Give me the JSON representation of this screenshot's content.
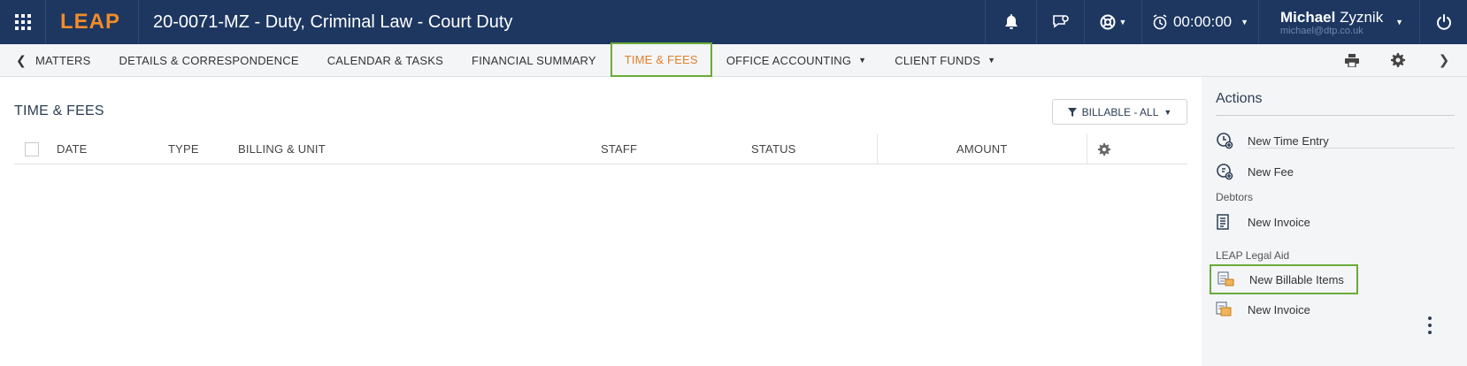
{
  "topbar": {
    "logo": "LEAP",
    "matter_title": "20-0071-MZ - Duty, Criminal Law - Court Duty",
    "timer": "00:00:00",
    "user_first": "Michael",
    "user_last": "Zyznik",
    "user_email": "michael@dtp.co.uk"
  },
  "nav": {
    "back_label": "MATTERS",
    "tabs": [
      {
        "label": "DETAILS & CORRESPONDENCE"
      },
      {
        "label": "CALENDAR & TASKS"
      },
      {
        "label": "FINANCIAL SUMMARY"
      },
      {
        "label": "TIME & FEES"
      },
      {
        "label": "OFFICE ACCOUNTING"
      },
      {
        "label": "CLIENT FUNDS"
      }
    ]
  },
  "main": {
    "title": "TIME & FEES",
    "filter_label": "BILLABLE - ALL",
    "columns": [
      "DATE",
      "TYPE",
      "BILLING & UNIT",
      "STAFF",
      "STATUS",
      "AMOUNT"
    ]
  },
  "panel": {
    "title": "Actions",
    "actions": [
      {
        "label": "New Time Entry",
        "icon": "clock-plus-icon"
      },
      {
        "label": "New Fee",
        "icon": "fee-plus-icon"
      }
    ],
    "groups": [
      {
        "label": "Debtors",
        "items": [
          {
            "label": "New Invoice",
            "icon": "invoice-icon"
          }
        ]
      },
      {
        "label": "LEAP Legal Aid",
        "items": [
          {
            "label": "New Billable Items",
            "icon": "billable-items-icon"
          },
          {
            "label": "New Invoice",
            "icon": "legal-aid-invoice-icon"
          }
        ]
      }
    ]
  },
  "colors": {
    "topbar_bg": "#1d3761",
    "logo": "#f28c28",
    "active_tab_text": "#e0802a",
    "highlight_border": "#6aab3a"
  }
}
